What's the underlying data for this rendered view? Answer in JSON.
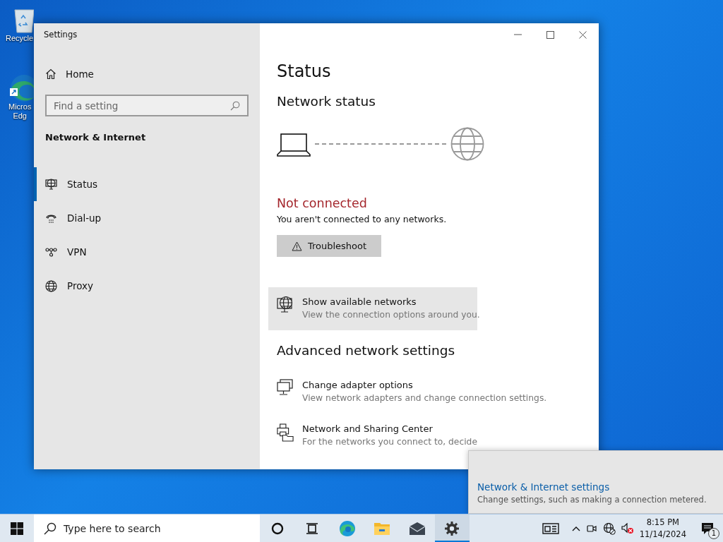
{
  "desktop_icons": [
    {
      "kind": "recycle-bin",
      "lines": [
        "Recycle"
      ]
    },
    {
      "kind": "browser",
      "lines": [
        "Micros",
        "Edg"
      ]
    }
  ],
  "window": {
    "title": "Settings"
  },
  "sidebar": {
    "home": "Home",
    "search": {
      "placeholder": "Find a setting"
    },
    "section": "Network & Internet",
    "items": [
      {
        "kind": "status",
        "label": "Status",
        "selected": true
      },
      {
        "kind": "dialup",
        "label": "Dial-up",
        "selected": false
      },
      {
        "kind": "vpn",
        "label": "VPN",
        "selected": false
      },
      {
        "kind": "proxy",
        "label": "Proxy",
        "selected": false
      }
    ]
  },
  "main": {
    "title": "Status",
    "network_status": {
      "heading": "Network status",
      "connected": false,
      "state": "Not connected",
      "message": "You aren't connected to any networks.",
      "button": "Troubleshoot"
    },
    "show_networks": {
      "title": "Show available networks",
      "description": "View the connection options around you.",
      "highlighted": true
    },
    "advanced": {
      "heading": "Advanced network settings",
      "items": [
        {
          "kind": "adapter",
          "title": "Change adapter options",
          "description": "View network adapters and change connection settings."
        },
        {
          "kind": "sharing",
          "title": "Network and Sharing Center",
          "description": "For the networks you connect to, decide"
        }
      ]
    }
  },
  "notification_popup": {
    "link": "Network & Internet settings",
    "description": "Change settings, such as making a connection metered."
  },
  "taskbar": {
    "search": {
      "placeholder": "Type here to search"
    },
    "apps": [
      {
        "kind": "cortana",
        "active": false
      },
      {
        "kind": "taskview",
        "active": false
      },
      {
        "kind": "edge",
        "active": false
      },
      {
        "kind": "explorer",
        "active": false
      },
      {
        "kind": "mail",
        "active": false
      },
      {
        "kind": "settings",
        "active": true
      }
    ],
    "tray": {
      "icons": [
        {
          "kind": "news"
        },
        {
          "kind": "caret"
        },
        {
          "kind": "meet"
        },
        {
          "kind": "network"
        },
        {
          "kind": "volume-muted"
        }
      ],
      "time": "8:15 PM",
      "date": "11/14/2024",
      "notification_count": "1"
    }
  }
}
